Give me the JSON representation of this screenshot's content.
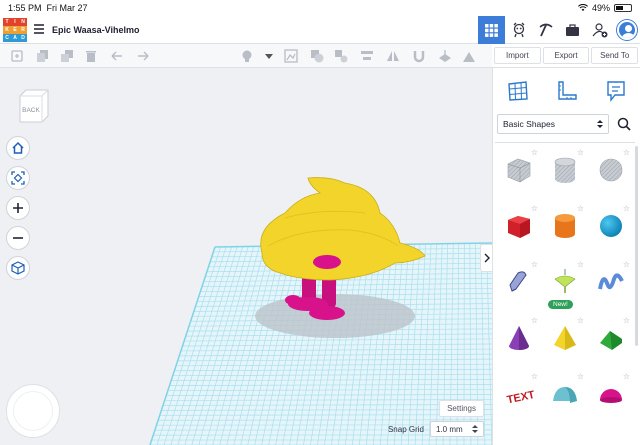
{
  "status_bar": {
    "time": "1:55 PM",
    "date": "Fri Mar 27",
    "battery": "49%"
  },
  "logo": {
    "letters": [
      "T",
      "I",
      "N",
      "K",
      "E",
      "R",
      "C",
      "A",
      "D"
    ],
    "colors": [
      "#e2412b",
      "#e2412b",
      "#e2412b",
      "#f0a033",
      "#f0a033",
      "#f0a033",
      "#2e9bd6",
      "#2e9bd6",
      "#2e9bd6"
    ]
  },
  "project": {
    "title": "Epic Waasa-Vihelmo"
  },
  "top_actions": {
    "import_label": "Import",
    "export_label": "Export",
    "send_to_label": "Send To"
  },
  "canvas": {
    "settings_label": "Settings",
    "snap_grid_label": "Snap Grid",
    "snap_grid_value": "1.0 mm",
    "viewcube_label": "BACK"
  },
  "panel": {
    "category": "Basic Shapes",
    "shapes": [
      {
        "name": "box-hole"
      },
      {
        "name": "cylinder-hole"
      },
      {
        "name": "sphere-hole"
      },
      {
        "name": "box"
      },
      {
        "name": "cylinder"
      },
      {
        "name": "sphere"
      },
      {
        "name": "scribble"
      },
      {
        "name": "new-shape",
        "badge": "New!"
      },
      {
        "name": "text-wave"
      },
      {
        "name": "cone"
      },
      {
        "name": "pyramid"
      },
      {
        "name": "roof"
      },
      {
        "name": "text"
      },
      {
        "name": "half-cylinder"
      },
      {
        "name": "half-sphere"
      }
    ]
  },
  "colors": {
    "accent": "#3b7dd8",
    "duck_body": "#f2d42a",
    "duck_pink": "#d8128a",
    "grid_line": "#7fd3e8"
  }
}
